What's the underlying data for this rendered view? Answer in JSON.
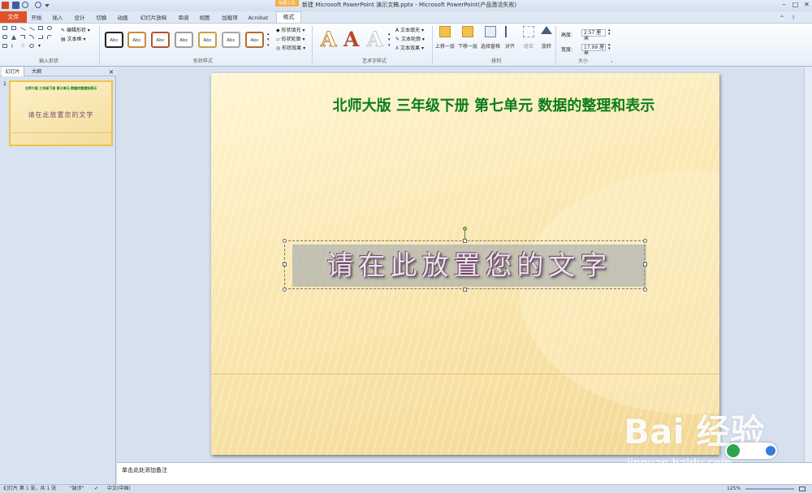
{
  "window": {
    "title": "新建 Microsoft PowerPoint 演示文稿.pptx - Microsoft PowerPoint(产品激活失败)",
    "context_tab": "绘图工具"
  },
  "tabs": {
    "file": "文件",
    "items": [
      "开始",
      "插入",
      "设计",
      "切换",
      "动画",
      "幻灯片放映",
      "审阅",
      "视图",
      "加载项",
      "Acrobat"
    ],
    "active": "格式"
  },
  "ribbon": {
    "insert_shapes": {
      "edit_shape": "编辑形状",
      "text_box": "文本框",
      "label": "插入形状"
    },
    "shape_styles": {
      "samples": [
        "Abc",
        "Abc",
        "Abc",
        "Abc",
        "Abc",
        "Abc",
        "Abc"
      ],
      "fill": "形状填充",
      "outline": "形状轮廓",
      "effects": "形状效果",
      "label": "形状样式"
    },
    "wordart_styles": {
      "letters": [
        "A",
        "A",
        "A"
      ],
      "text_fill": "文本填充",
      "text_outline": "文本轮廓",
      "text_effects": "文本效果",
      "label": "艺术字样式"
    },
    "arrange": {
      "bring_forward": "上移一层",
      "send_backward": "下移一层",
      "selection_pane": "选择窗格",
      "align": "对齐",
      "group": "组合",
      "rotate": "旋转",
      "label": "排列"
    },
    "size": {
      "height_label": "高度:",
      "height_value": "2.57 厘米",
      "width_label": "宽度:",
      "width_value": "17.99 厘米",
      "label": "大小"
    }
  },
  "left_pane": {
    "tab_slides": "幻灯片",
    "tab_outline": "大纲",
    "close": "×",
    "slide_number": "1",
    "thumb_title": "北师大版 三年级下册 第七单元 数据的整理和表示",
    "thumb_text": "请在此放置您的文字"
  },
  "slide": {
    "title": "北师大版  三年级下册  第七单元  数据的整理和表示",
    "wordart_text": "请在此放置您的文字"
  },
  "notes": {
    "placeholder": "单击此处添加备注"
  },
  "status_bar": {
    "slide_info": "幻灯片 第 1 张，共 1 张",
    "theme": "\"跋涉\"",
    "language": "中文(中国)",
    "zoom": "125%"
  },
  "watermark": {
    "brand": "Bai  经验",
    "url": "jingyan.baidu.com"
  },
  "colors": {
    "title_green": "#0b7d1a",
    "file_tab": "#e0522a",
    "context_tab": "#f4b04a",
    "slide_bg": "#fbe9b4"
  }
}
